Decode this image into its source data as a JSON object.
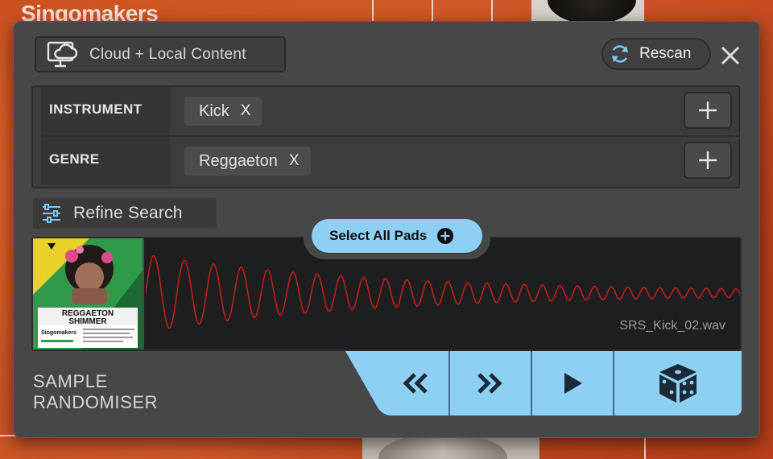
{
  "background": {
    "brand_text": "Singomakers"
  },
  "header": {
    "source_label": "Cloud + Local Content",
    "rescan_label": "Rescan"
  },
  "filters": [
    {
      "label": "INSTRUMENT",
      "tags": [
        {
          "text": "Kick",
          "remove": "X"
        }
      ]
    },
    {
      "label": "GENRE",
      "tags": [
        {
          "text": "Reggaeton",
          "remove": "X"
        }
      ]
    }
  ],
  "refine": {
    "label": "Refine Search"
  },
  "select_all": {
    "label": "Select All Pads"
  },
  "sample": {
    "filename": "SRS_Kick_02.wav",
    "cover": {
      "title_line1": "REGGAETON",
      "title_line2": "SHIMMER",
      "brand": "Singomakers"
    },
    "waveform_color": "#c01e18"
  },
  "footer": {
    "title_line1": "SAMPLE",
    "title_line2": "RANDOMISER"
  },
  "colors": {
    "accent": "#8ed0f4",
    "panel": "#474747",
    "dark_panel": "#353535"
  },
  "icons": {
    "source": "cloud-monitor-icon",
    "rescan": "refresh-icon",
    "close": "close-icon",
    "add": "plus-icon",
    "refine": "sliders-icon",
    "select_all": "plus-circle-icon",
    "prev": "rewind-icon",
    "next": "fast-forward-icon",
    "play": "play-icon",
    "random": "dice-icon"
  }
}
